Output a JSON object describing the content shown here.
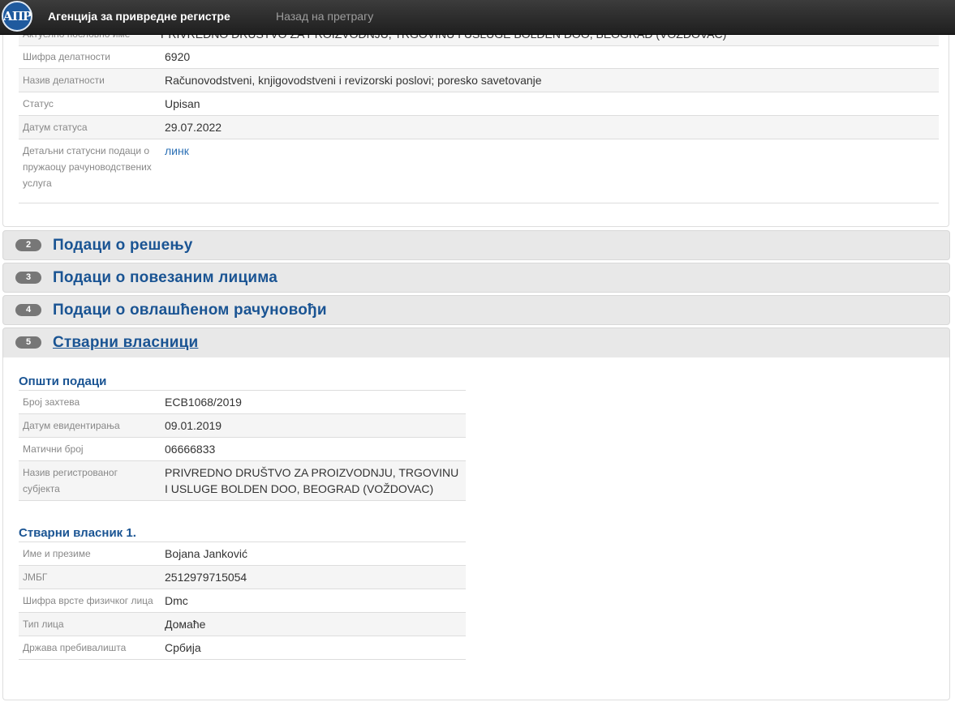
{
  "header": {
    "logo_text": "АПР",
    "brand": "Агенција за привредне регистре",
    "back_link": "Назад на претрагу"
  },
  "panel1": {
    "cut_row": {
      "label": "Актуелно пословно име",
      "value": "PRIVREDNO DRUŠTVO ZA PROIZVODNJU, TRGOVINU I USLUGE BOLDEN DOO, BEOGRAD (VOŽDOVAC)"
    },
    "rows": [
      {
        "label": "Шифра делатности",
        "value": "6920"
      },
      {
        "label": "Назив делатности",
        "value": "Računovodstveni, knjigovodstveni i revizorski poslovi; poresko savetovanje"
      },
      {
        "label": "Статус",
        "value": "Upisan"
      },
      {
        "label": "Датум статуса",
        "value": "29.07.2022"
      },
      {
        "label": "Детаљни статусни подаци о пружаоцу рачуноводствених услуга",
        "value": "линк"
      }
    ]
  },
  "accordion": [
    {
      "num": "2",
      "title": "Подаци о решењу"
    },
    {
      "num": "3",
      "title": "Подаци о повезаним лицима"
    },
    {
      "num": "4",
      "title": "Подаци о овлашћеном рачуновођи"
    },
    {
      "num": "5",
      "title": "Стварни власници"
    }
  ],
  "general": {
    "title": "Општи подаци",
    "rows": [
      {
        "label": "Број захтева",
        "value": "ECB1068/2019"
      },
      {
        "label": "Датум евидентирања",
        "value": "09.01.2019"
      },
      {
        "label": "Матични број",
        "value": "06666833"
      },
      {
        "label": "Назив регистрованог субјекта",
        "value": "PRIVREDNO DRUŠTVO ZA PROIZVODNJU, TRGOVINU I USLUGE BOLDEN DOO, BEOGRAD (VOŽDOVAC)"
      }
    ]
  },
  "owner": {
    "title": "Стварни власник 1.",
    "rows": [
      {
        "label": "Име и презиме",
        "value": "Bojana Janković"
      },
      {
        "label": "ЈМБГ",
        "value": "2512979715054"
      },
      {
        "label": "Шифра врсте физичког лица",
        "value": "Dmc"
      },
      {
        "label": "Тип лица",
        "value": "Домаће"
      },
      {
        "label": "Држава пребивалишта",
        "value": "Србија"
      }
    ]
  }
}
